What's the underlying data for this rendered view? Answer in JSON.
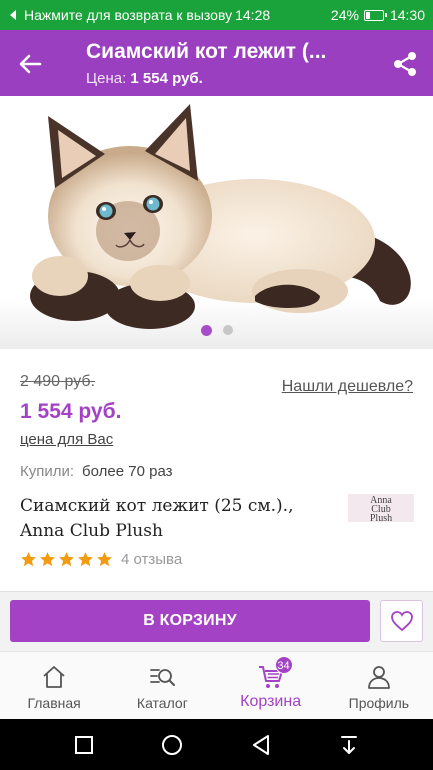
{
  "status_bar": {
    "call_text": "Нажмите для возврата к вызову",
    "call_time": "14:28",
    "battery_pct": "24%",
    "battery_level": 0.24,
    "clock": "14:30"
  },
  "app_bar": {
    "title": "Сиамский кот лежит (...",
    "price_label": "Цена:",
    "price_value": "1 554 руб."
  },
  "product": {
    "image_alt": "siamese-cat-plush",
    "carousel": {
      "count": 2,
      "active": 0
    },
    "old_price": "2 490 руб.",
    "cheaper_link": "Нашли дешевле?",
    "price": "1 554 руб.",
    "price_note": "цена для Вас",
    "bought_label": "Купили:",
    "bought_value": "более 70 раз",
    "title_line1": "Сиамский кот лежит (25 см.).,",
    "title_line2": "Anna Club Plush",
    "brand_logo": "Anna Club Plush",
    "rating": 5,
    "reviews": "4 отзыва"
  },
  "actions": {
    "cart_button": "В КОРЗИНУ",
    "favorite_icon": "heart-icon"
  },
  "bottom_nav": {
    "items": [
      {
        "label": "Главная",
        "icon": "home-icon"
      },
      {
        "label": "Каталог",
        "icon": "catalog-search-icon"
      },
      {
        "label": "Корзина",
        "icon": "cart-icon",
        "badge": "34",
        "active": true
      },
      {
        "label": "Профиль",
        "icon": "profile-icon"
      }
    ]
  },
  "colors": {
    "status_bar": "#1aa33a",
    "brand": "#9a3fbf",
    "accent": "#a342c4",
    "star": "#f39c12"
  }
}
